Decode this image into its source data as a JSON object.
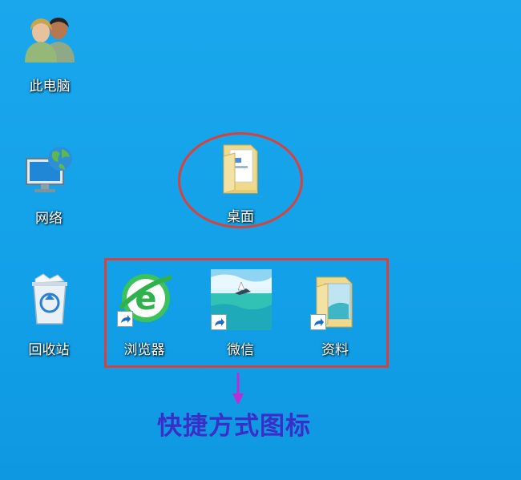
{
  "desktop": {
    "icons": [
      {
        "label": "此电脑",
        "icon": "user-accounts-icon"
      },
      {
        "label": "网络",
        "icon": "network-globe-icon"
      },
      {
        "label": "回收站",
        "icon": "recycle-bin-icon"
      },
      {
        "label": "桌面",
        "icon": "folder-icon"
      },
      {
        "label": "浏览器",
        "icon": "browser-e-icon"
      },
      {
        "label": "微信",
        "icon": "beach-image-icon"
      },
      {
        "label": "资料",
        "icon": "folder-icon"
      }
    ]
  },
  "annotation": {
    "caption": "快捷方式图标",
    "highlight_color": "#d9413c",
    "caption_color": "#3b2ec8",
    "arrow_color": "#c02bd6"
  }
}
